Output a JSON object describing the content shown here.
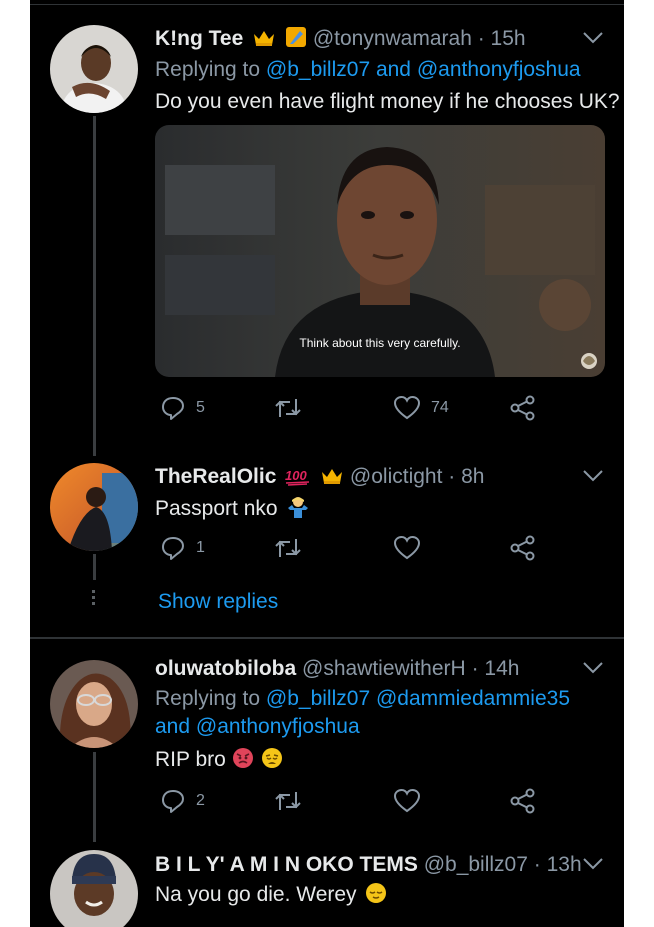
{
  "tweets": [
    {
      "name": "K!ng Tee",
      "handle": "@tonynwamarah",
      "time": "· 15h",
      "replying_prefix": "Replying to",
      "replying_to": "@b_billz07 and @anthonyfjoshua",
      "text": "Do you even have flight money if he chooses UK?",
      "media_caption": "Think about this very carefully.",
      "replies": "5",
      "retweets": "",
      "likes": "74"
    },
    {
      "name": "TheRealOlic",
      "handle": "@olictight",
      "time": "· 8h",
      "text": "Passport nko",
      "replies": "1",
      "retweets": "",
      "likes": ""
    },
    {
      "name": "oluwatobiloba",
      "handle": "@shawtiewitherH",
      "time": "· 14h",
      "replying_prefix": "Replying to",
      "replying_line1": "@b_billz07 @dammiedammie35",
      "replying_line2": "and @anthonyfjoshua",
      "text": "RIP bro",
      "replies": "2",
      "retweets": "",
      "likes": ""
    },
    {
      "name": "B I L Y' A M I N OKO TEMS",
      "handle": "@b_billz07",
      "time": "· 13h",
      "text": "Na you go die. Werey"
    }
  ],
  "show_replies": "Show replies",
  "colors": {
    "background": "#000000",
    "text": "#e7e9ea",
    "secondary": "#8b98a5",
    "link": "#1d9bf0",
    "divider": "#2f3336"
  },
  "icons": [
    "reply-icon",
    "retweet-icon",
    "like-icon",
    "share-icon",
    "chevron-down-icon",
    "crown-emoji",
    "hundred-emoji",
    "flag-emoji",
    "shrug-emoji",
    "angry-face-emoji",
    "weary-face-emoji",
    "relieved-face-emoji"
  ]
}
